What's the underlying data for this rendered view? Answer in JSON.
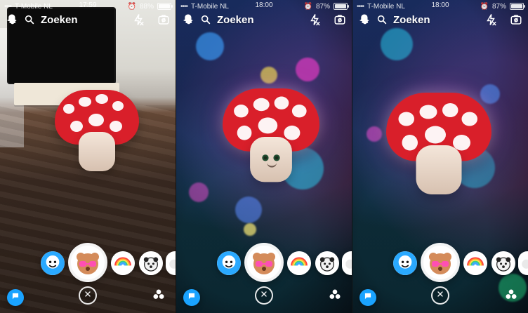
{
  "panels": [
    {
      "status": {
        "carrier": "T-Mobile NL",
        "time": "17:59",
        "battery_percent": "88%",
        "battery_level": 0.88
      },
      "search_label": "Zoeken"
    },
    {
      "status": {
        "carrier": "T-Mobile NL",
        "time": "18:00",
        "battery_percent": "87%",
        "battery_level": 0.87
      },
      "search_label": "Zoeken"
    },
    {
      "status": {
        "carrier": "T-Mobile NL",
        "time": "18:00",
        "battery_percent": "87%",
        "battery_level": 0.87
      },
      "search_label": "Zoeken"
    }
  ],
  "icons": {
    "snapchat": "ghost-icon",
    "search": "search-icon",
    "flash": "flash-off-icon",
    "flip_camera": "flip-camera-icon",
    "chat": "chat-icon",
    "close": "close-icon",
    "stories": "stories-icon"
  },
  "colors": {
    "mushroom_red": "#d91f2a",
    "chat_blue": "#1aa3ff"
  }
}
